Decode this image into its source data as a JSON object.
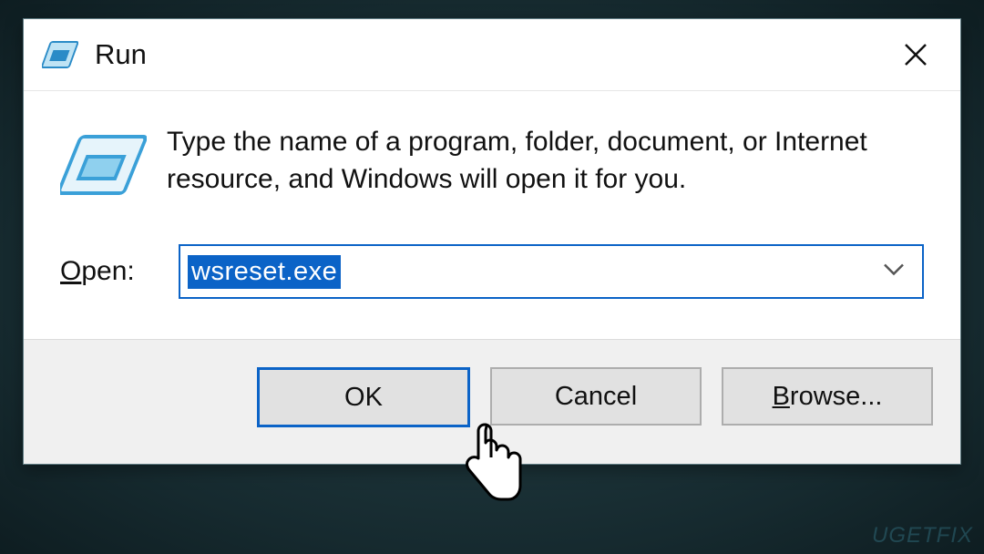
{
  "dialog": {
    "title": "Run",
    "description": "Type the name of a program, folder, document, or Internet resource, and Windows will open it for you.",
    "open_label_prefix": "O",
    "open_label_rest": "pen:",
    "input_value": "wsreset.exe",
    "buttons": {
      "ok": "OK",
      "cancel": "Cancel",
      "browse_prefix": "B",
      "browse_rest": "rowse..."
    }
  },
  "watermark": "UGETFIX"
}
